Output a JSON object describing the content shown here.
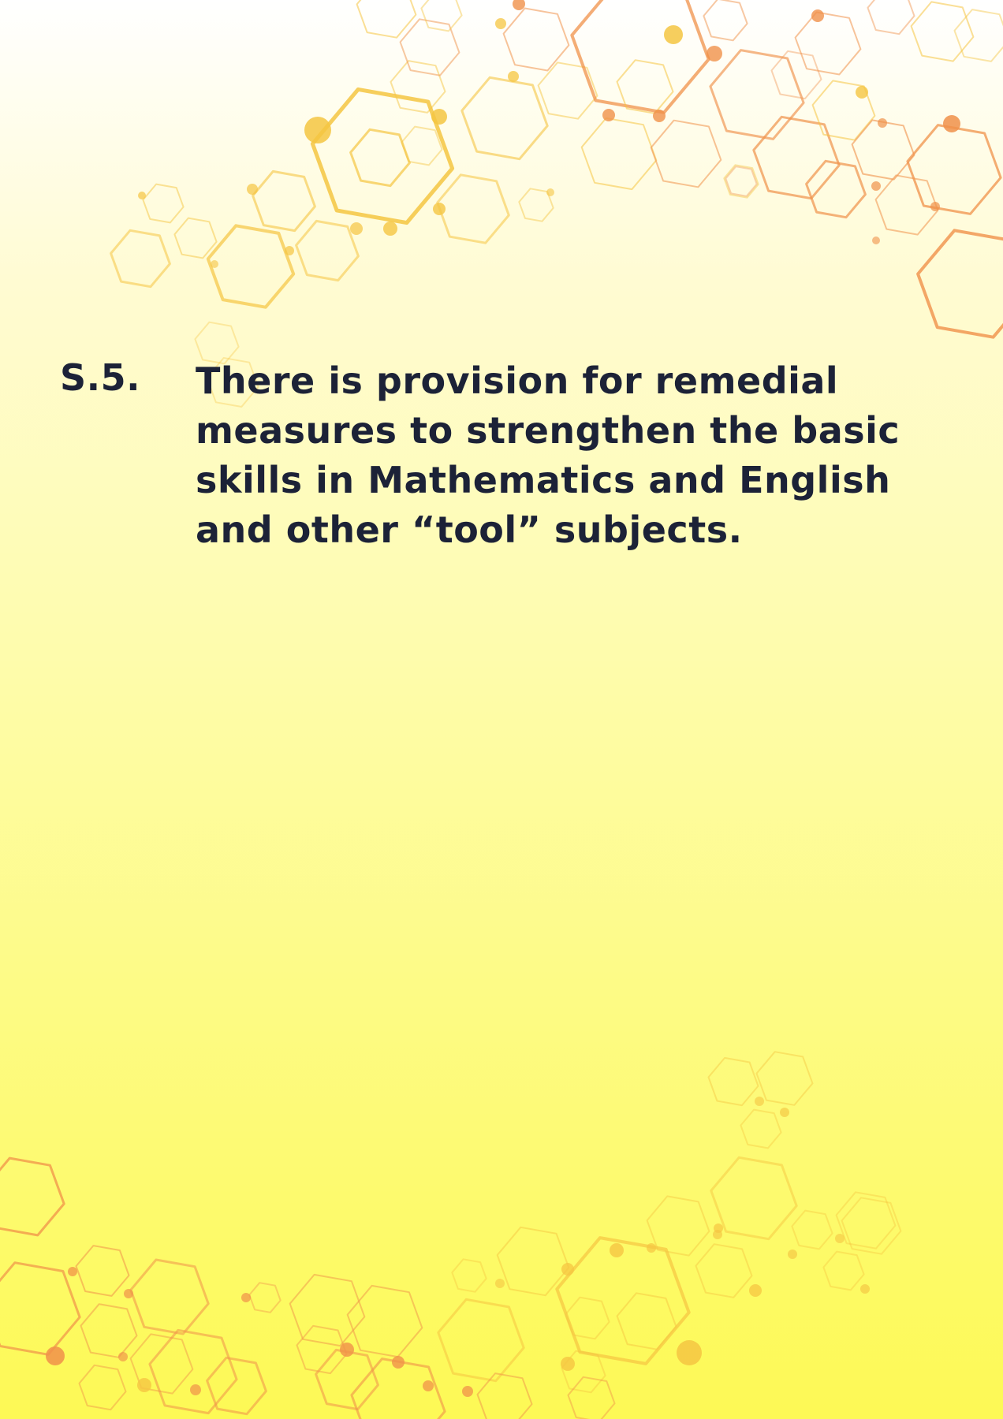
{
  "item": {
    "number": "S.5.",
    "text": "There is provision for remedial measures to strengthen the basic skills in Mathematics and English and other “tool” subjects."
  },
  "decoration": {
    "pattern": "hexagon-network",
    "colors": {
      "yellow": "#f5c542",
      "orange": "#f0914a",
      "gold": "#f6b84a"
    }
  }
}
